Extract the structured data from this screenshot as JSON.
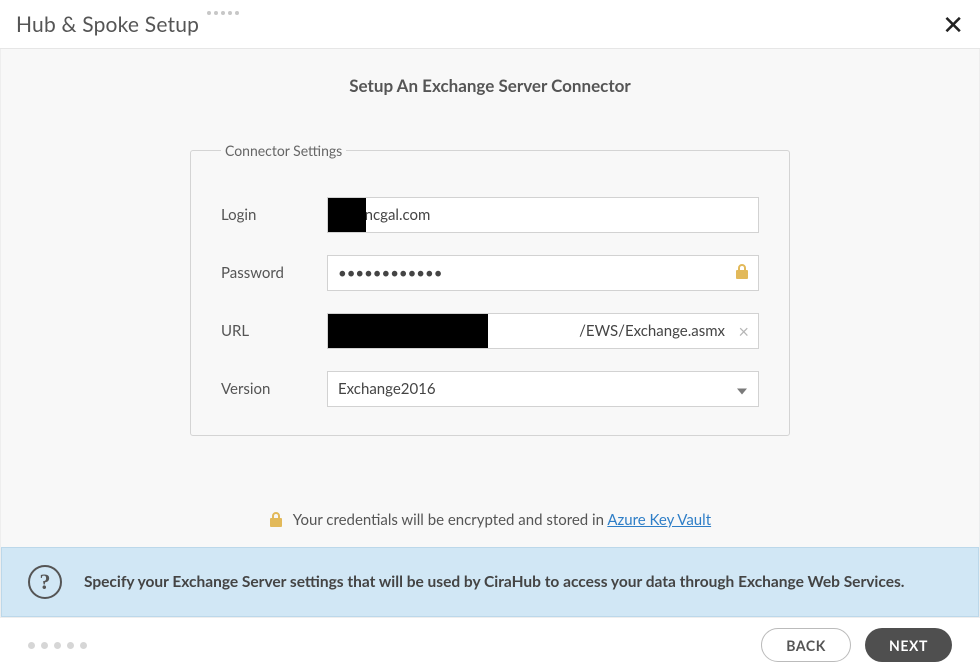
{
  "header": {
    "title": "Hub & Spoke Setup"
  },
  "page": {
    "subtitle": "Setup An Exchange Server Connector"
  },
  "fieldset": {
    "legend": "Connector Settings"
  },
  "fields": {
    "login": {
      "label": "Login",
      "value": "@syncgal.com"
    },
    "password": {
      "label": "Password",
      "value": "••••••••••••"
    },
    "url": {
      "label": "URL",
      "value_visible": "/EWS/Exchange.asmx"
    },
    "version": {
      "label": "Version",
      "value": "Exchange2016"
    }
  },
  "notice": {
    "prefix": "Your credentials will be encrypted and stored in ",
    "link_text": "Azure Key Vault"
  },
  "help": {
    "text": "Specify your Exchange Server settings that will be used by CiraHub to access your data through Exchange Web Services."
  },
  "footer": {
    "back": "BACK",
    "next": "NEXT"
  }
}
